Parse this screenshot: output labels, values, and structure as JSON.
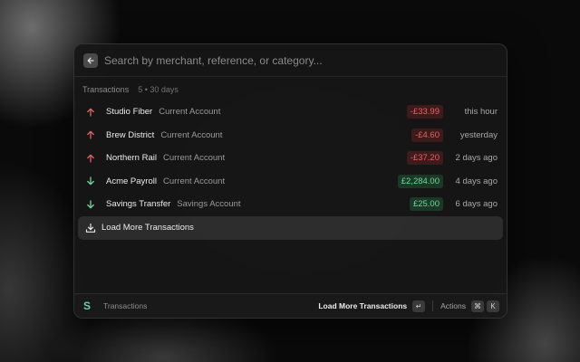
{
  "search": {
    "placeholder": "Search by merchant, reference, or category..."
  },
  "section": {
    "title": "Transactions",
    "meta": "5 • 30 days"
  },
  "transactions": [
    {
      "direction": "out",
      "merchant": "Studio Fiber",
      "account": "Current Account",
      "amount": "-£33.99",
      "when": "this hour"
    },
    {
      "direction": "out",
      "merchant": "Brew District",
      "account": "Current Account",
      "amount": "-£4.60",
      "when": "yesterday"
    },
    {
      "direction": "out",
      "merchant": "Northern Rail",
      "account": "Current Account",
      "amount": "-£37.20",
      "when": "2 days ago"
    },
    {
      "direction": "in",
      "merchant": "Acme Payroll",
      "account": "Current Account",
      "amount": "£2,284.00",
      "when": "4 days ago"
    },
    {
      "direction": "in",
      "merchant": "Savings Transfer",
      "account": "Savings Account",
      "amount": "£25.00",
      "when": "6 days ago"
    }
  ],
  "load_more": {
    "label": "Load More Transactions"
  },
  "footer": {
    "logo": "S",
    "extension_name": "Transactions",
    "primary_action": "Load More Transactions",
    "primary_key": "↵",
    "actions_label": "Actions",
    "actions_keys": [
      "⌘",
      "K"
    ]
  },
  "colors": {
    "negative": "#e4645c",
    "positive": "#6fd99a",
    "accent": "#5fd69a"
  },
  "icons": {
    "back": "arrow-left-icon",
    "out": "arrow-up-icon",
    "in": "arrow-down-icon",
    "load": "download-icon"
  }
}
